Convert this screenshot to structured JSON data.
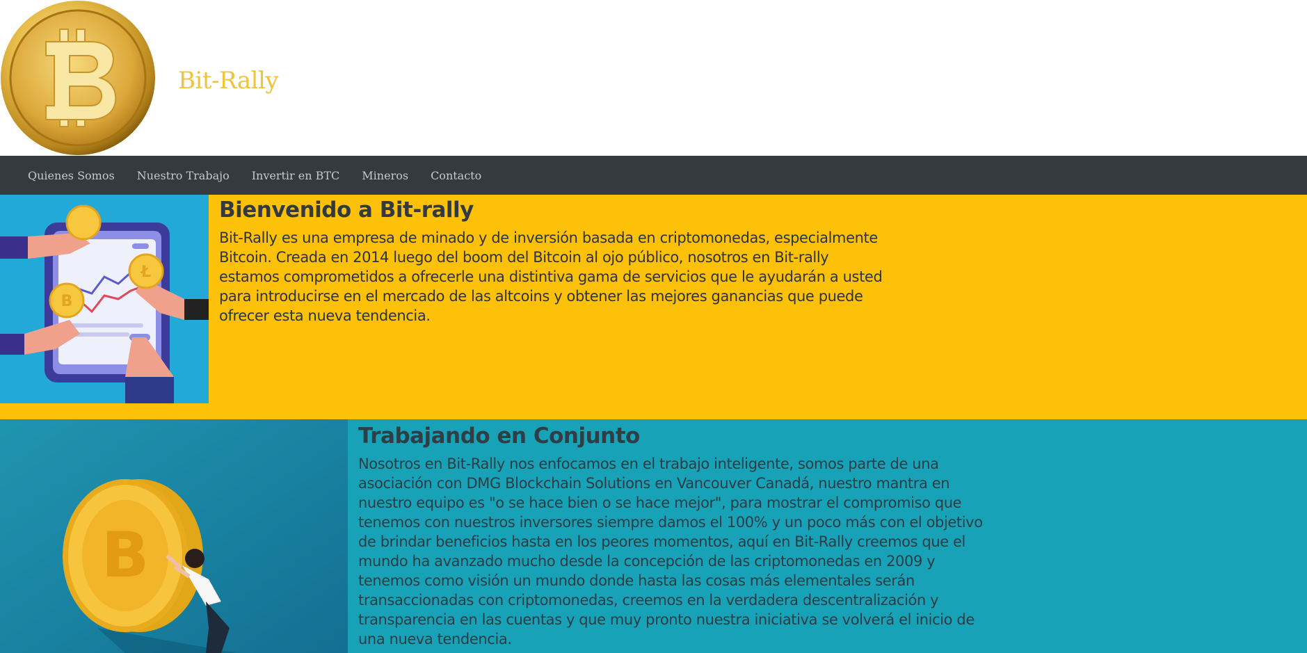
{
  "header": {
    "brand": "Bit-Rally",
    "logo_icon": "bitcoin-coin-icon",
    "colors": {
      "brand": "#f0c33a"
    }
  },
  "nav": {
    "items": [
      {
        "label": "Quienes Somos"
      },
      {
        "label": "Nuestro Trabajo"
      },
      {
        "label": "Invertir en BTC"
      },
      {
        "label": "Mineros"
      },
      {
        "label": "Contacto"
      }
    ],
    "colors": {
      "background": "#343a40",
      "link": "#c8c9cb"
    }
  },
  "sections": [
    {
      "title": "Bienvenido a Bit-rally",
      "text": "Bit-Rally es una empresa de minado y de inversión basada en criptomonedas, especialmente Bitcoin. Creada en 2014 luego del boom del Bitcoin al ojo público, nosotros en Bit-rally estamos comprometidos a ofrecerle una distintiva gama de servicios que le ayudarán a usted para introducirse en el mercado de las altcoins y obtener las mejores ganancias que puede ofrecer esta nueva tendencia.",
      "image": "crypto-trading-tablet-illustration",
      "background": "#fcc108"
    },
    {
      "title": "Trabajando en Conjunto",
      "text": "Nosotros en Bit-Rally nos enfocamos en el trabajo inteligente, somos parte de una asociación con DMG Blockchain Solutions en Vancouver Canadá, nuestro mantra en nuestro equipo es \"o se hace bien o se hace mejor\", para mostrar el compromiso que tenemos con nuestros inversores siempre damos el 100% y un poco más con el objetivo de brindar beneficios hasta en los peores momentos, aquí en Bit-Rally creemos que el mundo ha avanzado mucho desde la concepción de las criptomonedas en 2009 y tenemos como visión un mundo donde hasta las cosas más elementales serán transaccionadas con criptomonedas, creemos en la verdadera descentralización y transparencia en las cuentas y que muy pronto nuestra iniciativa se volverá el inicio de una nueva tendencia.",
      "image": "woman-pushing-bitcoin-illustration",
      "background": "#17a2b8"
    }
  ]
}
